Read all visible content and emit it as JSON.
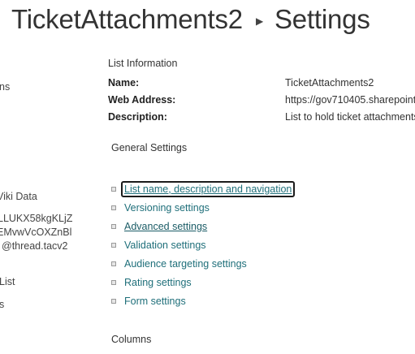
{
  "header": {
    "list_name": "TicketAttachments2",
    "separator_icon": "triangle-right",
    "page_name": "Settings"
  },
  "leftnav": {
    "items": [
      "ns",
      "Viki Data",
      "LLUKX58kgKLjZ",
      "EMvwVcOXZnBl",
      "@thread.tacv2",
      "List",
      "s"
    ]
  },
  "list_information": {
    "heading": "List Information",
    "name_label": "Name:",
    "name_value": "TicketAttachments2",
    "web_address_label": "Web Address:",
    "web_address_value": "https://gov710405.sharepoint",
    "description_label": "Description:",
    "description_value": "List to hold ticket attachments"
  },
  "general_settings": {
    "heading": "General Settings",
    "links": [
      "List name, description and navigation",
      "Versioning settings",
      "Advanced settings",
      "Validation settings",
      "Audience targeting settings",
      "Rating settings",
      "Form settings"
    ]
  },
  "columns": {
    "heading": "Columns"
  },
  "colors": {
    "link": "#1f6f7a",
    "text": "#333333",
    "focus_border": "#1b1b1b"
  }
}
